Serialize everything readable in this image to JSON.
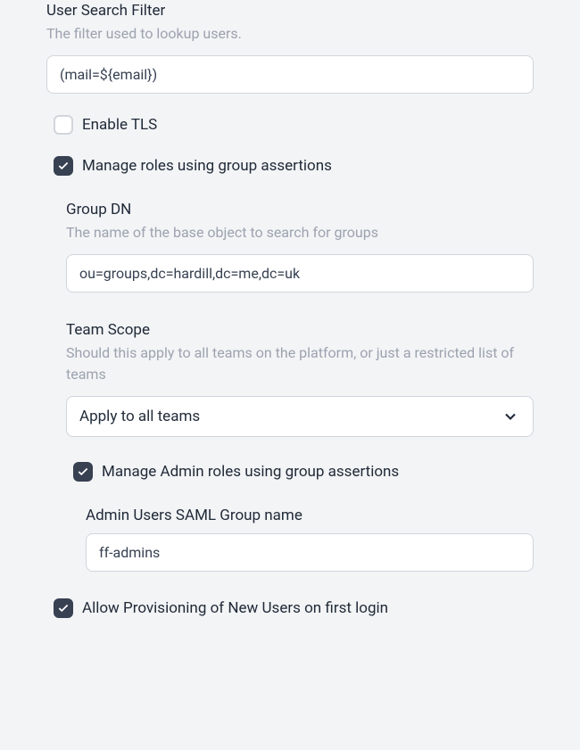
{
  "userSearchFilter": {
    "label": "User Search Filter",
    "description": "The filter used to lookup users.",
    "value": "(mail=${email})"
  },
  "enableTls": {
    "label": "Enable TLS",
    "checked": false
  },
  "manageRoles": {
    "label": "Manage roles using group assertions",
    "checked": true
  },
  "groupDn": {
    "label": "Group DN",
    "description": "The name of the base object to search for groups",
    "value": "ou=groups,dc=hardill,dc=me,dc=uk"
  },
  "teamScope": {
    "label": "Team Scope",
    "description": "Should this apply to all teams on the platform, or just a restricted list of teams",
    "selected": "Apply to all teams"
  },
  "manageAdminRoles": {
    "label": "Manage Admin roles using group assertions",
    "checked": true
  },
  "adminGroup": {
    "label": "Admin Users SAML Group name",
    "value": "ff-admins"
  },
  "allowProvisioning": {
    "label": "Allow Provisioning of New Users on first login",
    "checked": true
  }
}
